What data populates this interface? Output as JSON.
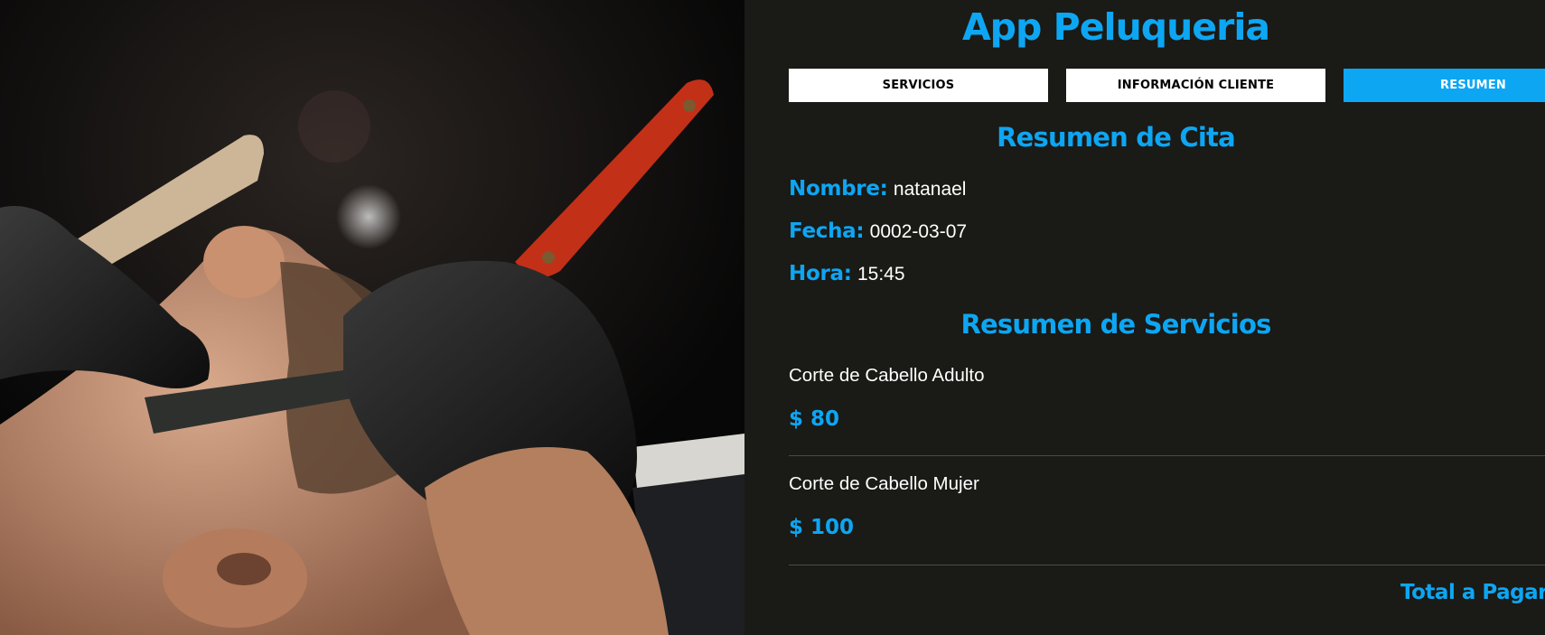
{
  "app": {
    "title": "App Peluqueria"
  },
  "hero": {
    "image": "barber-shaving-photo"
  },
  "tabs": [
    {
      "label": "SERVICIOS",
      "active": false
    },
    {
      "label": "INFORMACIÓN CLIENTE",
      "active": false
    },
    {
      "label": "RESUMEN",
      "active": true
    }
  ],
  "cita": {
    "heading": "Resumen de Cita",
    "nombre_label": "Nombre:",
    "nombre_value": "natanael",
    "fecha_label": "Fecha:",
    "fecha_value": "0002-03-07",
    "hora_label": "Hora:",
    "hora_value": "15:45"
  },
  "servicios": {
    "heading": "Resumen de Servicios",
    "items": [
      {
        "name": "Corte de Cabello Adulto",
        "price": "$ 80"
      },
      {
        "name": "Corte de Cabello Mujer",
        "price": "$ 100"
      }
    ],
    "total_label": "Total a Pagar"
  },
  "colors": {
    "accent": "#0da6f3",
    "background": "#1a1a16",
    "tab_inactive": "#ffffff",
    "text": "#ffffff"
  }
}
